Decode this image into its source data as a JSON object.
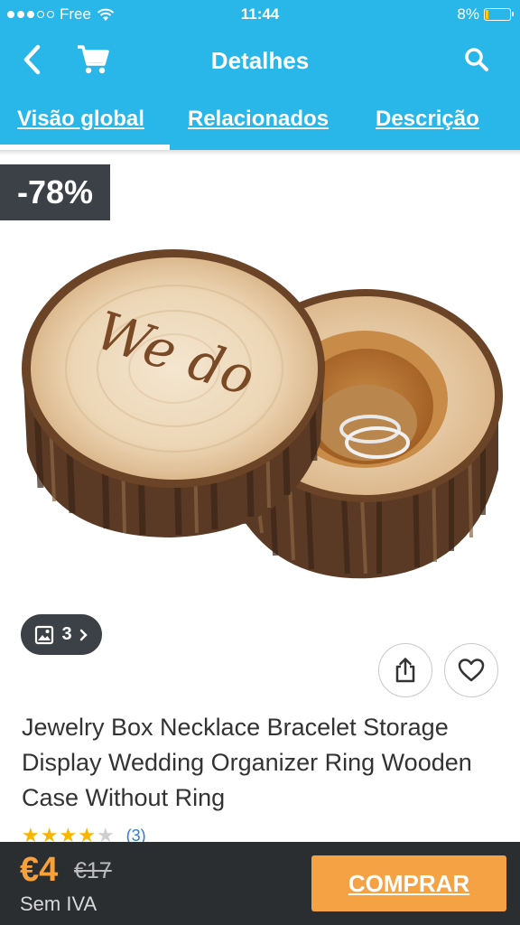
{
  "status_bar": {
    "carrier": "Free",
    "time": "11:44",
    "battery": "8%",
    "signal_icon": "signal-dots-icon",
    "wifi_icon": "wifi-icon",
    "battery_icon": "battery-icon"
  },
  "app_bar": {
    "title": "Detalhes",
    "back_icon": "chevron-left-icon",
    "cart_icon": "cart-icon",
    "search_icon": "search-icon"
  },
  "tabs": [
    {
      "label": "Visão global",
      "active": true
    },
    {
      "label": "Relacionados",
      "active": false
    },
    {
      "label": "Descrição",
      "active": false
    }
  ],
  "product": {
    "discount": "-78%",
    "image_engraving": "We do",
    "image_count": "3",
    "title": "Jewelry Box Necklace Bracelet Storage Display Wedding Organizer Ring Wooden Case Without Ring",
    "rating": 4,
    "rating_max": 5,
    "review_count": "(3)"
  },
  "purchase": {
    "price": "€4",
    "old_price": "€17",
    "vat_note": "Sem IVA",
    "buy_label": "COMPRAR"
  },
  "colors": {
    "brand": "#29b6e8",
    "dark": "#3b4146",
    "accent": "#f5a244",
    "star": "#f7b500"
  }
}
